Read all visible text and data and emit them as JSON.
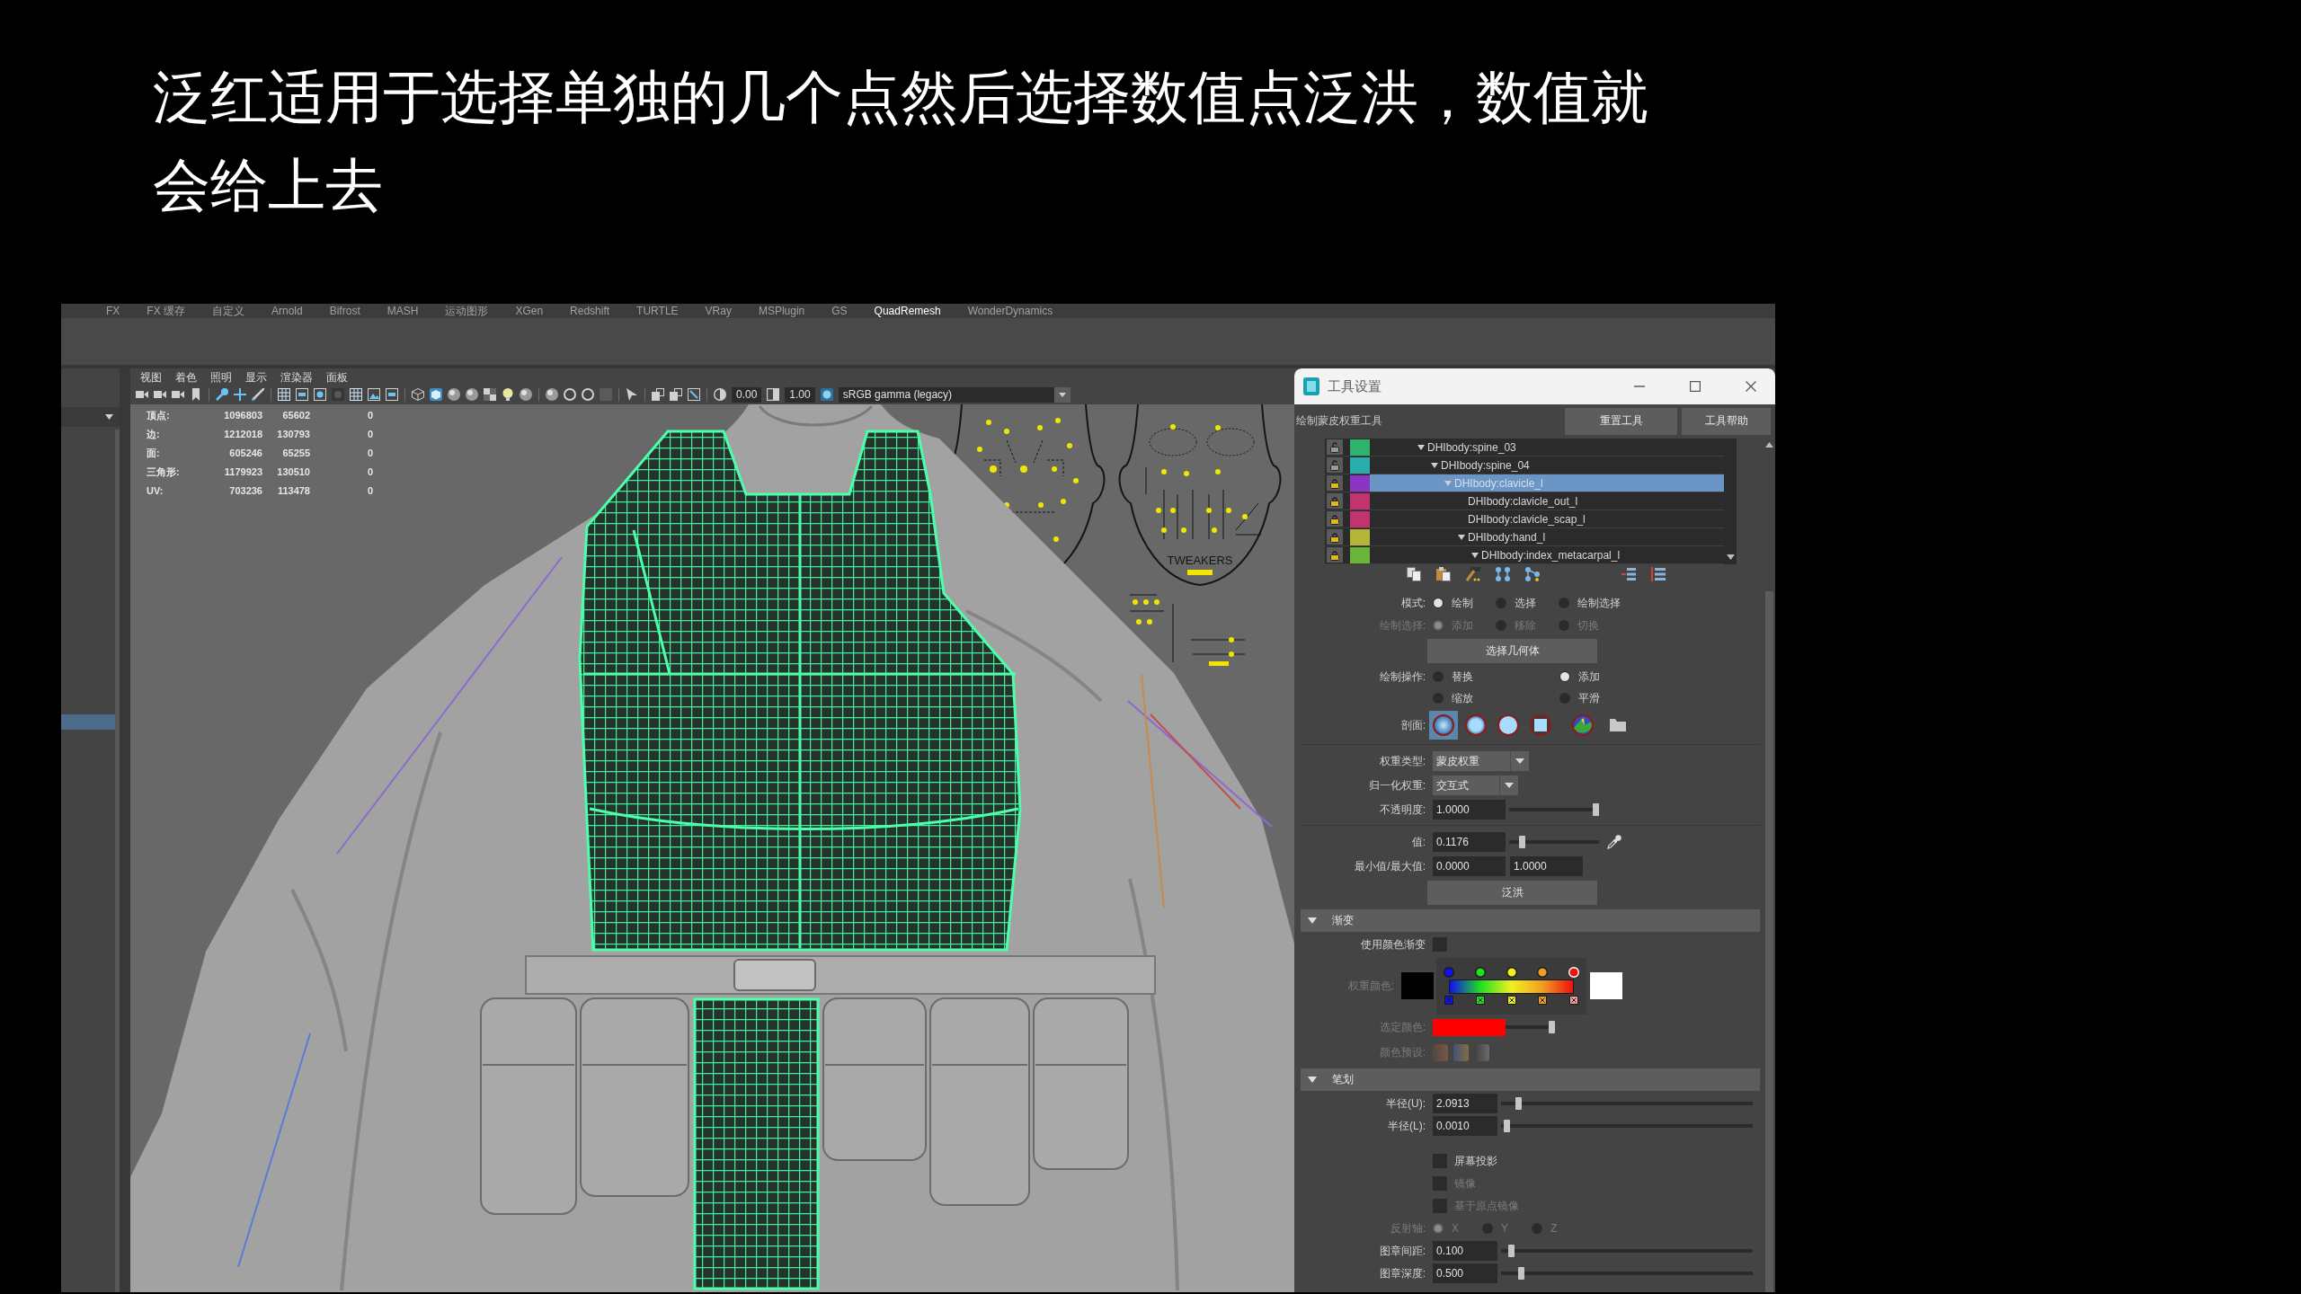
{
  "caption": {
    "text": "泛红适用于选择单独的几个点然后选择数值点泛洪，数值就会给上去"
  },
  "shelf_tabs": [
    {
      "label": "FX",
      "selected": false
    },
    {
      "label": "FX 缓存",
      "selected": false
    },
    {
      "label": "自定义",
      "selected": false
    },
    {
      "label": "Arnold",
      "selected": false
    },
    {
      "label": "Bifrost",
      "selected": false
    },
    {
      "label": "MASH",
      "selected": false
    },
    {
      "label": "运动图形",
      "selected": false
    },
    {
      "label": "XGen",
      "selected": false
    },
    {
      "label": "Redshift",
      "selected": false
    },
    {
      "label": "TURTLE",
      "selected": false
    },
    {
      "label": "VRay",
      "selected": false
    },
    {
      "label": "MSPlugin",
      "selected": false
    },
    {
      "label": "GS",
      "selected": false
    },
    {
      "label": "QuadRemesh",
      "selected": true
    },
    {
      "label": "WonderDynamics",
      "selected": false
    }
  ],
  "left_panel": {
    "rows": [
      {
        "selected": true
      }
    ]
  },
  "viewport": {
    "menu": [
      "视图",
      "着色",
      "照明",
      "显示",
      "渲染器",
      "面板"
    ],
    "toolbar": {
      "exposure": "0.00",
      "gamma": "1.00",
      "color_space": "sRGB gamma (legacy)"
    },
    "stats": [
      {
        "label": "顶点:",
        "values": [
          "1096803",
          "65602",
          "0"
        ]
      },
      {
        "label": "边:",
        "values": [
          "1212018",
          "130793",
          "0"
        ]
      },
      {
        "label": "面:",
        "values": [
          "605246",
          "65255",
          "0"
        ]
      },
      {
        "label": "三角形:",
        "values": [
          "1179923",
          "130510",
          "0"
        ]
      },
      {
        "label": "UV:",
        "values": [
          "703236",
          "113478",
          "0"
        ]
      }
    ],
    "rig_label": "TWEAKERS"
  },
  "tool_settings": {
    "title": "工具设置",
    "tool_name": "绘制蒙皮权重工具",
    "header_buttons": [
      "重置工具",
      "工具帮助"
    ],
    "influences": [
      {
        "name": "DHIbody:spine_03",
        "color": "#2db36b",
        "locked": false,
        "expanded": true,
        "selected": false,
        "children": [
          {
            "name": "DHIbody:spine_04",
            "color": "#2aadad",
            "locked": false,
            "expanded": true,
            "selected": false,
            "children": [
              {
                "name": "DHIbody:clavicle_l",
                "color": "#8a35c4",
                "locked": true,
                "expanded": true,
                "selected": true,
                "children": [
                  {
                    "name": "DHIbody:clavicle_out_l",
                    "color": "#c2336f",
                    "locked": true,
                    "selected": false
                  },
                  {
                    "name": "DHIbody:clavicle_scap_l",
                    "color": "#c2336f",
                    "locked": true,
                    "selected": false
                  },
                  {
                    "name": "DHIbody:hand_l",
                    "color": "#b5b53a",
                    "locked": true,
                    "expanded": true,
                    "selected": false,
                    "children": [
                      {
                        "name": "DHIbody:index_metacarpal_l",
                        "color": "#6ab43c",
                        "locked": true,
                        "expanded": true,
                        "selected": false
                      }
                    ]
                  }
                ]
              }
            ]
          }
        ]
      }
    ],
    "groups": [
      [
        {
          "kind": "radio-row",
          "label": "模式:",
          "disabled": false,
          "options": [
            {
              "label": "绘制",
              "selected": true
            },
            {
              "label": "选择",
              "selected": false
            },
            {
              "label": "绘制选择",
              "selected": false
            }
          ]
        },
        {
          "kind": "radio-row",
          "label": "绘制选择:",
          "disabled": true,
          "options": [
            {
              "label": "添加",
              "selected": true
            },
            {
              "label": "移除",
              "selected": false
            },
            {
              "label": "切换",
              "selected": false
            }
          ]
        },
        {
          "kind": "button",
          "label": "选择几何体"
        },
        {
          "kind": "radio-grid",
          "label": "绘制操作:",
          "disabled": false,
          "options": [
            {
              "label": "替换",
              "selected": false
            },
            {
              "label": "添加",
              "selected": true
            },
            {
              "label": "缩放",
              "selected": false
            },
            {
              "label": "平滑",
              "selected": false
            }
          ]
        },
        {
          "kind": "profiles",
          "label": "剖面:",
          "brushes": [
            {
              "kind": "gaussian",
              "selected": true
            },
            {
              "kind": "soft",
              "selected": false
            },
            {
              "kind": "solid",
              "selected": false
            },
            {
              "kind": "square",
              "selected": false
            },
            {
              "kind": "image",
              "selected": false
            }
          ]
        }
      ],
      [
        {
          "kind": "dropdown",
          "label": "权重类型:",
          "value": "蒙皮权重"
        },
        {
          "kind": "dropdown",
          "label": "归一化权重:",
          "value": "交互式"
        },
        {
          "kind": "slider",
          "label": "不透明度:",
          "value": "1.0000",
          "level": 1
        }
      ],
      [
        {
          "kind": "slider",
          "label": "值:",
          "value": "0.1176",
          "level": 0.12,
          "eyedropper": true
        },
        {
          "kind": "range",
          "label": "最小值/最大值:",
          "min": "0.0000",
          "max": "1.0000"
        },
        {
          "kind": "button",
          "label": "泛洪"
        }
      ]
    ],
    "sections": [
      {
        "title": "渐变",
        "expanded": true,
        "rows": [
          {
            "kind": "check-field",
            "label": "使用颜色渐变",
            "checked": false
          },
          {
            "kind": "ramp",
            "label": "权重颜色:",
            "disabled": true,
            "stops": [
              {
                "color": "#1010f0",
                "selected": false
              },
              {
                "color": "#20e020",
                "selected": false
              },
              {
                "color": "#f0f020",
                "selected": false
              },
              {
                "color": "#f0a020",
                "selected": false
              },
              {
                "color": "#f01010",
                "selected": true
              }
            ]
          },
          {
            "kind": "color-slider",
            "label": "选定颜色:",
            "disabled": true,
            "color": "#ff0000",
            "level": 1
          },
          {
            "kind": "presets",
            "label": "颜色预设:",
            "disabled": true
          }
        ]
      },
      {
        "title": "笔划",
        "expanded": true,
        "rows": [
          {
            "kind": "slider",
            "label": "半径(U):",
            "value": "2.0913",
            "level": 0.06
          },
          {
            "kind": "slider",
            "label": "半径(L):",
            "value": "0.0010",
            "level": 0.01
          },
          {
            "kind": "checkbox",
            "label": "屏幕投影",
            "checked": false,
            "disabled": false
          },
          {
            "kind": "checkbox",
            "label": "镜像",
            "checked": false,
            "disabled": true
          },
          {
            "kind": "checkbox",
            "label": "基于原点镜像",
            "checked": false,
            "disabled": true
          },
          {
            "kind": "radio-axis",
            "label": "反射轴:",
            "disabled": true,
            "options": [
              {
                "label": "X",
                "selected": true
              },
              {
                "label": "Y",
                "selected": false
              },
              {
                "label": "Z",
                "selected": false
              }
            ]
          },
          {
            "kind": "slider",
            "label": "图章间距:",
            "value": "0.100",
            "level": 0.03
          },
          {
            "kind": "slider",
            "label": "图章深度:",
            "value": "0.500",
            "level": 0.07
          }
        ]
      }
    ]
  }
}
